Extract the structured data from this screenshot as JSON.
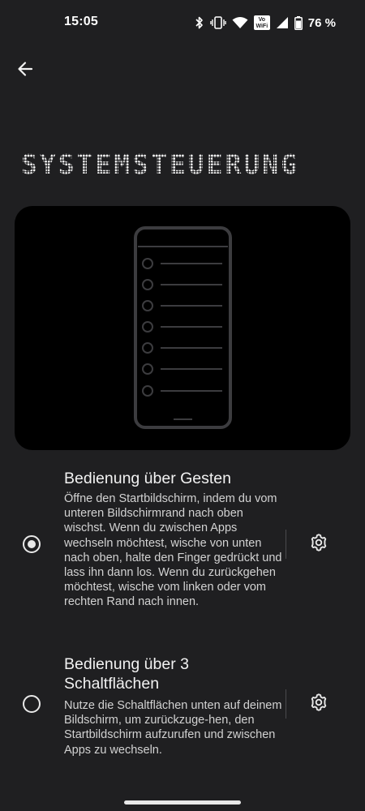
{
  "status_bar": {
    "time": "15:05",
    "vowifi_line1": "Vo",
    "vowifi_line2": "WiFi",
    "battery": "76 %"
  },
  "page": {
    "title": "SYSTEMSTEUERUNG"
  },
  "options": [
    {
      "title": "Bedienung über Gesten",
      "description": "Öffne den Startbildschirm, indem du vom unteren Bildschirmrand nach oben wischst. Wenn du zwischen Apps wechseln möchtest, wische von unten nach oben, halte den Finger gedrückt und lass ihn dann los. Wenn du zurückgehen möchtest, wische vom linken oder vom rechten Rand nach innen.",
      "selected": true
    },
    {
      "title": "Bedienung über 3 Schaltflächen",
      "description": "Nutze die Schaltflächen unten auf deinem Bildschirm, um zurückzuge-hen, den Startbildschirm aufzurufen und zwischen Apps zu wechseln.",
      "selected": false
    }
  ],
  "icons": {
    "back": "arrow-left-icon",
    "settings": "gear-icon",
    "bluetooth": "bluetooth-icon",
    "vibrate": "vibrate-icon",
    "wifi": "wifi-icon",
    "signal": "signal-icon",
    "battery": "battery-icon"
  },
  "colors": {
    "background": "#1f1f21",
    "illustration_bg": "#000000",
    "text_primary": "#f2f2f2",
    "text_secondary": "#d2d2d2"
  }
}
